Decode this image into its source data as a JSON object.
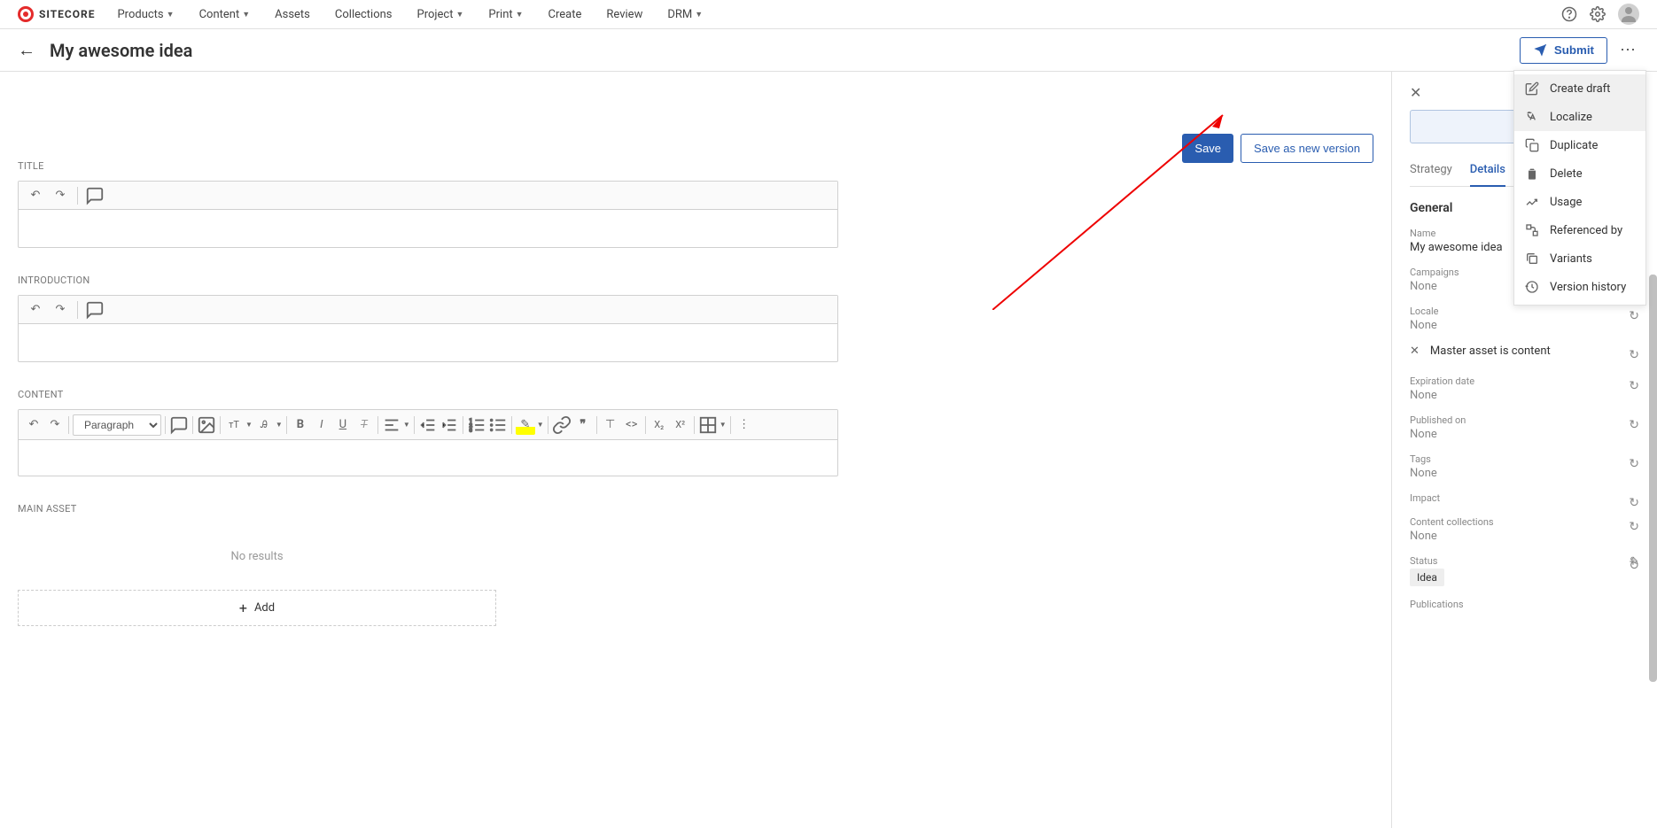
{
  "brand": "SITECORE",
  "nav": {
    "products": "Products",
    "content": "Content",
    "assets": "Assets",
    "collections": "Collections",
    "project": "Project",
    "print": "Print",
    "create": "Create",
    "review": "Review",
    "drm": "DRM"
  },
  "page_title": "My awesome idea",
  "submit_label": "Submit",
  "buttons": {
    "save": "Save",
    "save_as_new": "Save as new version",
    "add": "Add"
  },
  "fields": {
    "title": "TITLE",
    "introduction": "INTRODUCTION",
    "content": "CONTENT",
    "main_asset": "MAIN ASSET",
    "no_results": "No results",
    "format_select": "Paragraph"
  },
  "panel": {
    "tab_strategy": "Strategy",
    "tab_details": "Details",
    "section_general": "General",
    "name_label": "Name",
    "name_value": "My awesome idea",
    "campaigns_label": "Campaigns",
    "campaigns_value": "None",
    "locale_label": "Locale",
    "locale_value": "None",
    "master_asset": "Master asset is content",
    "expiration_label": "Expiration date",
    "expiration_value": "None",
    "published_label": "Published on",
    "published_value": "None",
    "tags_label": "Tags",
    "tags_value": "None",
    "impact_label": "Impact",
    "collections_label": "Content collections",
    "collections_value": "None",
    "status_label": "Status",
    "status_value": "Idea",
    "publications_label": "Publications"
  },
  "menu": {
    "create_draft": "Create draft",
    "localize": "Localize",
    "duplicate": "Duplicate",
    "delete": "Delete",
    "usage": "Usage",
    "referenced_by": "Referenced by",
    "variants": "Variants",
    "version_history": "Version history"
  }
}
